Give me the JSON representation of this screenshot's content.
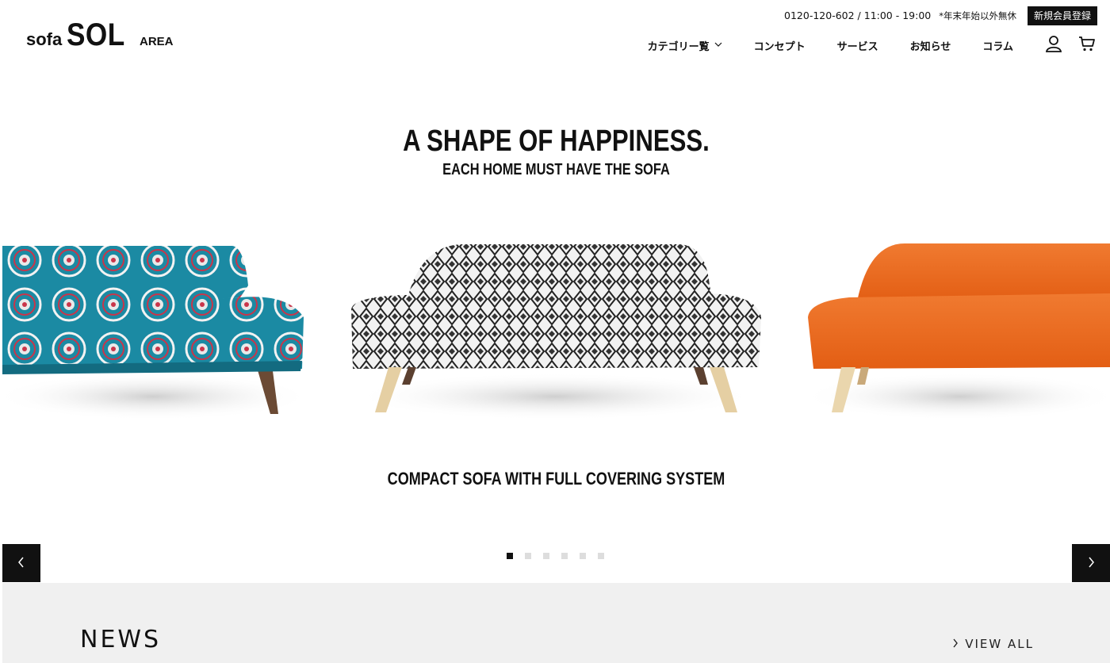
{
  "header": {
    "logo_sofa": "sofa",
    "logo_sol": "SOL",
    "logo_area": "AREA",
    "phone_hours": "0120-120-602 / 11:00 - 19:00",
    "holiday_note": "*年末年始以外無休",
    "signup_label": "新規会員登録",
    "nav": [
      {
        "label": "カテゴリー覧"
      },
      {
        "label": "コンセプト"
      },
      {
        "label": "サービス"
      },
      {
        "label": "お知らせ"
      },
      {
        "label": "コラム"
      }
    ]
  },
  "hero": {
    "headline": "A SHAPE OF HAPPINESS.",
    "subheadline": "EACH HOME MUST HAVE THE SOFA",
    "tagline": "COMPACT SOFA WITH FULL COVERING SYSTEM",
    "slide_count": 6,
    "active_slide": 1,
    "sofa_colors": {
      "left": "#1f8fa6",
      "center": "#e8e8e8",
      "right": "#ef6a1e"
    }
  },
  "news": {
    "title": "NEWS",
    "view_all_label": "VIEW ALL"
  }
}
